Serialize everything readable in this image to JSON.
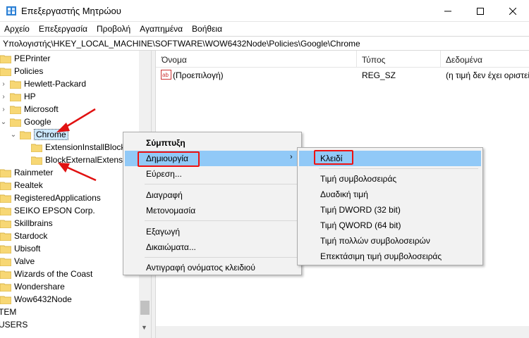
{
  "window": {
    "title": "Επεξεργαστής Μητρώου"
  },
  "menu": [
    "Αρχείο",
    "Επεξεργασία",
    "Προβολή",
    "Αγαπημένα",
    "Βοήθεια"
  ],
  "address": "Υπολογιστής\\HKEY_LOCAL_MACHINE\\SOFTWARE\\WOW6432Node\\Policies\\Google\\Chrome",
  "tree": {
    "items": [
      {
        "label": "PEPrinter"
      },
      {
        "label": "Policies"
      },
      {
        "label": "Hewlett-Packard"
      },
      {
        "label": "HP"
      },
      {
        "label": "Microsoft"
      },
      {
        "label": "Google"
      },
      {
        "label": "Chrome"
      },
      {
        "label": "ExtensionInstallBlock"
      },
      {
        "label": "BlockExternalExtensi"
      },
      {
        "label": "Rainmeter"
      },
      {
        "label": "Realtek"
      },
      {
        "label": "RegisteredApplications"
      },
      {
        "label": "SEIKO EPSON Corp."
      },
      {
        "label": "Skillbrains"
      },
      {
        "label": "Stardock"
      },
      {
        "label": "Ubisoft"
      },
      {
        "label": "Valve"
      },
      {
        "label": "Wizards of the Coast"
      },
      {
        "label": "Wondershare"
      },
      {
        "label": "Wow6432Node"
      },
      {
        "label": "TEM"
      },
      {
        "label": "USERS"
      }
    ]
  },
  "list": {
    "headers": [
      "Όνομα",
      "Τύπος",
      "Δεδομένα"
    ],
    "rows": [
      {
        "name": "(Προεπιλογή)",
        "type": "REG_SZ",
        "data": "(η τιμή δεν έχει οριστεί)"
      }
    ]
  },
  "context_menu": {
    "items": [
      "Σύμπτυξη",
      "Δημιουργία",
      "Εύρεση...",
      "Διαγραφή",
      "Μετονομασία",
      "Εξαγωγή",
      "Δικαιώματα...",
      "Αντιγραφή ονόματος κλειδιού"
    ]
  },
  "submenu": {
    "items": [
      "Κλειδί",
      "Τιμή συμβολοσειράς",
      "Δυαδική τιμή",
      "Τιμή DWORD (32 bit)",
      "Τιμή QWORD (64 bit)",
      "Τιμή πολλών συμβολοσειρών",
      "Επεκτάσιμη τιμή συμβολοσειράς"
    ]
  },
  "colors": {
    "folder": "#f7d774",
    "highlight": "#91c9f7",
    "annotation": "#e11111"
  },
  "icons": {
    "app": "regedit-icon",
    "minimize": "minimize-icon",
    "maximize": "maximize-icon",
    "close": "close-icon",
    "folder": "folder-icon",
    "value": "string-value-icon",
    "submenu": "chevron-right-icon"
  }
}
